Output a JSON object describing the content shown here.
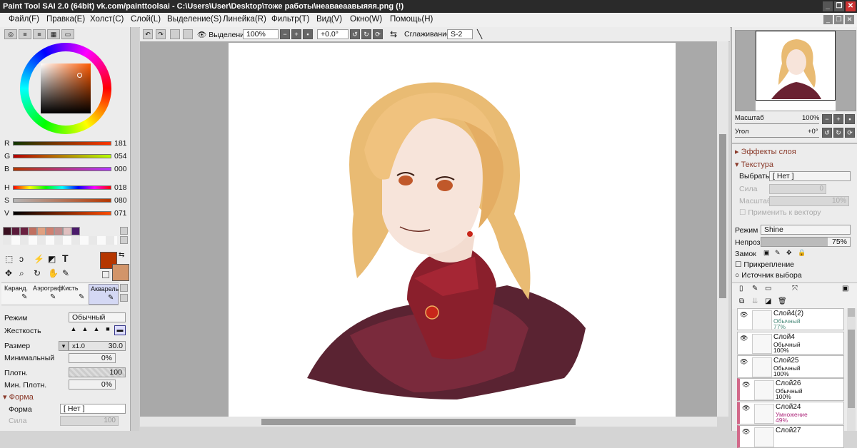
{
  "window": {
    "title": "Paint Tool SAI 2.0 (64bit) vk.com/painttoolsai - C:\\Users\\User\\Desktop\\тоже работы\\неаваеаавыяяя.png (!)",
    "buttons": [
      "_",
      "❐",
      "✕"
    ]
  },
  "menu": [
    "Файл(F)",
    "Правка(E)",
    "Холст(C)",
    "Слой(L)",
    "Выделение(S)",
    "Линейка(R)",
    "Фильтр(T)",
    "Вид(V)",
    "Окно(W)",
    "Помощь(H)"
  ],
  "toolbar": {
    "selection_label": "Выделение",
    "zoom": "100%",
    "angle": "+0.0°",
    "smoothing_label": "Сглаживание",
    "smoothing_value": "S-2"
  },
  "color": {
    "rgb": [
      {
        "label": "R",
        "value": "181"
      },
      {
        "label": "G",
        "value": "054"
      },
      {
        "label": "B",
        "value": "000"
      }
    ],
    "hsv": [
      {
        "label": "H",
        "value": "018"
      },
      {
        "label": "S",
        "value": "080"
      },
      {
        "label": "V",
        "value": "071"
      }
    ],
    "primary": "#b53600",
    "secondary": "#d2956a",
    "swatches": [
      "#3a1020",
      "#5a1a3a",
      "#6a2040",
      "#c07060",
      "#e0a080",
      "#d08070",
      "#c08a8a",
      "#e0c0c0",
      "#4a1a6a"
    ]
  },
  "brushes": [
    "Каранд.",
    "Аэрограф",
    "Кисть",
    "Акварель"
  ],
  "brush_settings": {
    "mode_label": "Режим",
    "mode_value": "Обычный",
    "hardness_label": "Жесткость",
    "size_label": "Размер",
    "size_mult": "x1.0",
    "size_value": "30.0",
    "min_label": "Минимальный",
    "min_value": "0%",
    "density_label": "Плотн.",
    "density_value": "100",
    "min_density_label": "Мин. Плотн.",
    "min_density_value": "0%",
    "form_section": "Форма",
    "form_label": "Форма",
    "form_value": "[ Нет ]",
    "strength_label": "Сила",
    "strength_value": "100"
  },
  "navigator": {
    "scale_label": "Масштаб",
    "scale_value": "100%",
    "angle_label": "Угол",
    "angle_value": "+0°"
  },
  "layer_panel": {
    "effects": "Эффекты слоя",
    "texture": "Текстура",
    "select_label": "Выбрать",
    "select_value": "[ Нет ]",
    "strength_label": "Сила",
    "strength_value": "0",
    "scale_label": "Масштаб",
    "scale_value": "10%",
    "apply_vector": "Применить к вектору",
    "mode_label": "Режим",
    "mode_value": "Shine",
    "opacity_label": "Непроз.",
    "opacity_value": "75%",
    "lock_label": "Замок",
    "clip_label": "Прикрепление",
    "source_label": "Источник выбора"
  },
  "layers": [
    {
      "name": "Слой4(2)",
      "mode": "Обычный",
      "opacity": "77%",
      "accent": "#4a8a7a"
    },
    {
      "name": "Слой4",
      "mode": "Обычный",
      "opacity": "100%",
      "accent": "#111"
    },
    {
      "name": "Слой25",
      "mode": "Обычный",
      "opacity": "100%",
      "accent": "#111"
    },
    {
      "name": "Слой26",
      "mode": "Обычный",
      "opacity": "100%",
      "accent": "#111"
    },
    {
      "name": "Слой24",
      "mode": "Умножение",
      "opacity": "49%",
      "accent": "#b03080"
    },
    {
      "name": "Слой27",
      "mode": "",
      "opacity": "",
      "accent": "#111"
    }
  ]
}
